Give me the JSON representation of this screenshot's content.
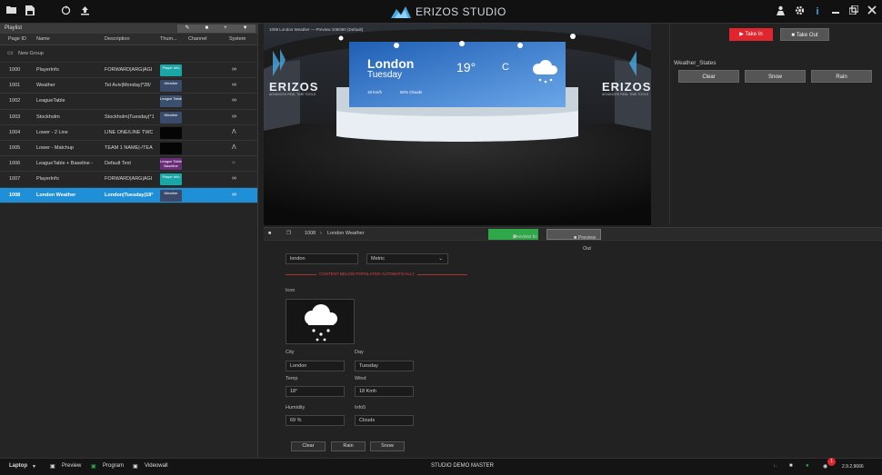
{
  "app": {
    "name": "ERIZOS STUDIO",
    "version": "2.9.2.9666"
  },
  "playlist": {
    "title": "Playlist",
    "columns": [
      "Page ID",
      "Name",
      "Description",
      "Thum...",
      "Channel",
      "System"
    ],
    "group": "New Group",
    "rows": [
      {
        "id": "1000",
        "name": "PlayerInfo",
        "desc": "FORWARD|ARG|AGI",
        "thumb": "Player Info",
        "thumb_color": "#1aa6a6"
      },
      {
        "id": "1001",
        "name": "Weather",
        "desc": "Tel Aviv|Monday|*28/",
        "thumb": "Weather",
        "thumb_color": "#3a4a6a"
      },
      {
        "id": "1002",
        "name": "LeagueTable",
        "desc": "",
        "thumb": "League Table",
        "thumb_color": "#3b4f6f"
      },
      {
        "id": "1003",
        "name": "Stockholm",
        "desc": "Stockholm|Tuesday|*1",
        "thumb": "Weather",
        "thumb_color": "#3a4a6a"
      },
      {
        "id": "1004",
        "name": "Lower - 2 Line",
        "desc": "LINE ONE/LINE TWC",
        "thumb": "",
        "thumb_color": "#050505"
      },
      {
        "id": "1005",
        "name": "Lower - Matchup",
        "desc": "TEAM 1 NAME|-/TEA",
        "thumb": "",
        "thumb_color": "#050505"
      },
      {
        "id": "1006",
        "name": "LeagueTable + Baseline -",
        "desc": "Default Text",
        "thumb": "League Table Baseline",
        "thumb_color": "#6b2d7a"
      },
      {
        "id": "1007",
        "name": "PlayerInfo",
        "desc": "FORWARD|ARG|AGI",
        "thumb": "Player Info",
        "thumb_color": "#1aa6a6"
      },
      {
        "id": "1008",
        "name": "London Weather",
        "desc": "London|Tuesday|18°",
        "thumb": "Weather",
        "thumb_color": "#3a4a6a"
      }
    ]
  },
  "viewport": {
    "overlay": "1008 London Weather — Preview 1080i50 (Default)",
    "city": "London",
    "day": "Tuesday",
    "temp": "19°",
    "unit": "C",
    "wind": "18 km/h",
    "condition": "50% Clouds",
    "brand": "ERIZOS",
    "brand_sub": "ADVANCED REAL TIME TOOLS"
  },
  "program": {
    "take_in": "Take In",
    "take_out": "Take Out",
    "states_label": "Weather_States",
    "states": [
      "Clear",
      "Snow",
      "Rain"
    ]
  },
  "editor": {
    "page_id": "1008",
    "page_name": "London Weather",
    "preview_in": "Preview In",
    "preview_out": "Preview Out",
    "location": "london",
    "units": "Metric",
    "notice": "CONTENT BELOW POPULATED AUTOMATICALLY",
    "icon_label": "Icon",
    "city_label": "City",
    "city": "London",
    "day_label": "Day",
    "day": "Tuesday",
    "temp_label": "Temp",
    "temp": "18°",
    "wind_label": "Wind",
    "wind": "18 Kmh",
    "humidity_label": "Humidity",
    "humidity": "69 %",
    "info_label": "Info5",
    "info": "Clouds",
    "buttons": [
      "Clear",
      "Rain",
      "Snow"
    ]
  },
  "statusbar": {
    "device": "Laptop",
    "preview": "Preview",
    "program": "Program",
    "videowall": "Videowall",
    "center": "STUDIO DEMO MASTER",
    "badge": "1"
  }
}
